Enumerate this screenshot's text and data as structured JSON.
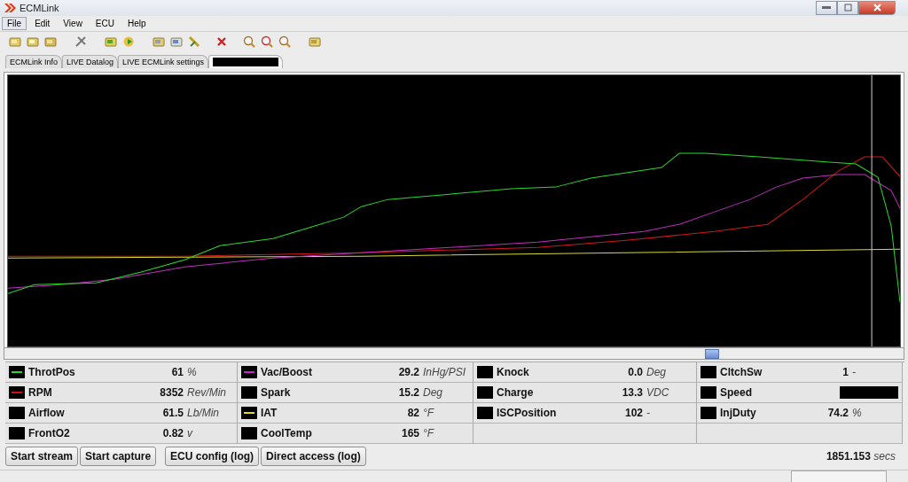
{
  "window": {
    "title": "ECMLink"
  },
  "menu": [
    {
      "label": "File",
      "highlighted": true
    },
    {
      "label": "Edit",
      "highlighted": false
    },
    {
      "label": "View",
      "highlighted": false
    },
    {
      "label": "ECU",
      "highlighted": false
    },
    {
      "label": "Help",
      "highlighted": false
    }
  ],
  "tabs": [
    {
      "label": "ECMLink Info",
      "selected": false
    },
    {
      "label": "LIVE Datalog",
      "selected": false
    },
    {
      "label": "LIVE ECMLink settings",
      "selected": false
    },
    {
      "redacted": true,
      "selected": true
    }
  ],
  "channels": [
    [
      {
        "name": "ThrotPos",
        "value": "61",
        "unit": "%",
        "color": "#22dd22"
      },
      {
        "name": "RPM",
        "value": "8352",
        "unit": "Rev/Min",
        "color": "#cc1111"
      },
      {
        "name": "Airflow",
        "value": "61.5",
        "unit": "Lb/Min"
      },
      {
        "name": "FrontO2",
        "value": "0.82",
        "unit": "v"
      }
    ],
    [
      {
        "name": "Vac/Boost",
        "value": "29.2",
        "unit": "InHg/PSI",
        "color": "#cc22cc"
      },
      {
        "name": "Spark",
        "value": "15.2",
        "unit": "Deg"
      },
      {
        "name": "IAT",
        "value": "82",
        "unit": "°F",
        "color": "#dddd22"
      },
      {
        "name": "CoolTemp",
        "value": "165",
        "unit": "°F"
      }
    ],
    [
      {
        "name": "Knock",
        "value": "0.0",
        "unit": "Deg"
      },
      {
        "name": "Charge",
        "value": "13.3",
        "unit": "VDC"
      },
      {
        "name": "ISCPosition",
        "value": "102",
        "unit": "-"
      }
    ],
    [
      {
        "name": "CltchSw",
        "value": "1",
        "unit": "-"
      },
      {
        "name": "Speed",
        "value_redacted": true
      },
      {
        "name": "InjDuty",
        "value": "74.2",
        "unit": "%"
      }
    ]
  ],
  "buttons": [
    "Start stream",
    "Start capture",
    "ECU config (log)",
    "Direct access (log)"
  ],
  "elapsed": {
    "value": "1851.153",
    "unit": "secs"
  }
}
